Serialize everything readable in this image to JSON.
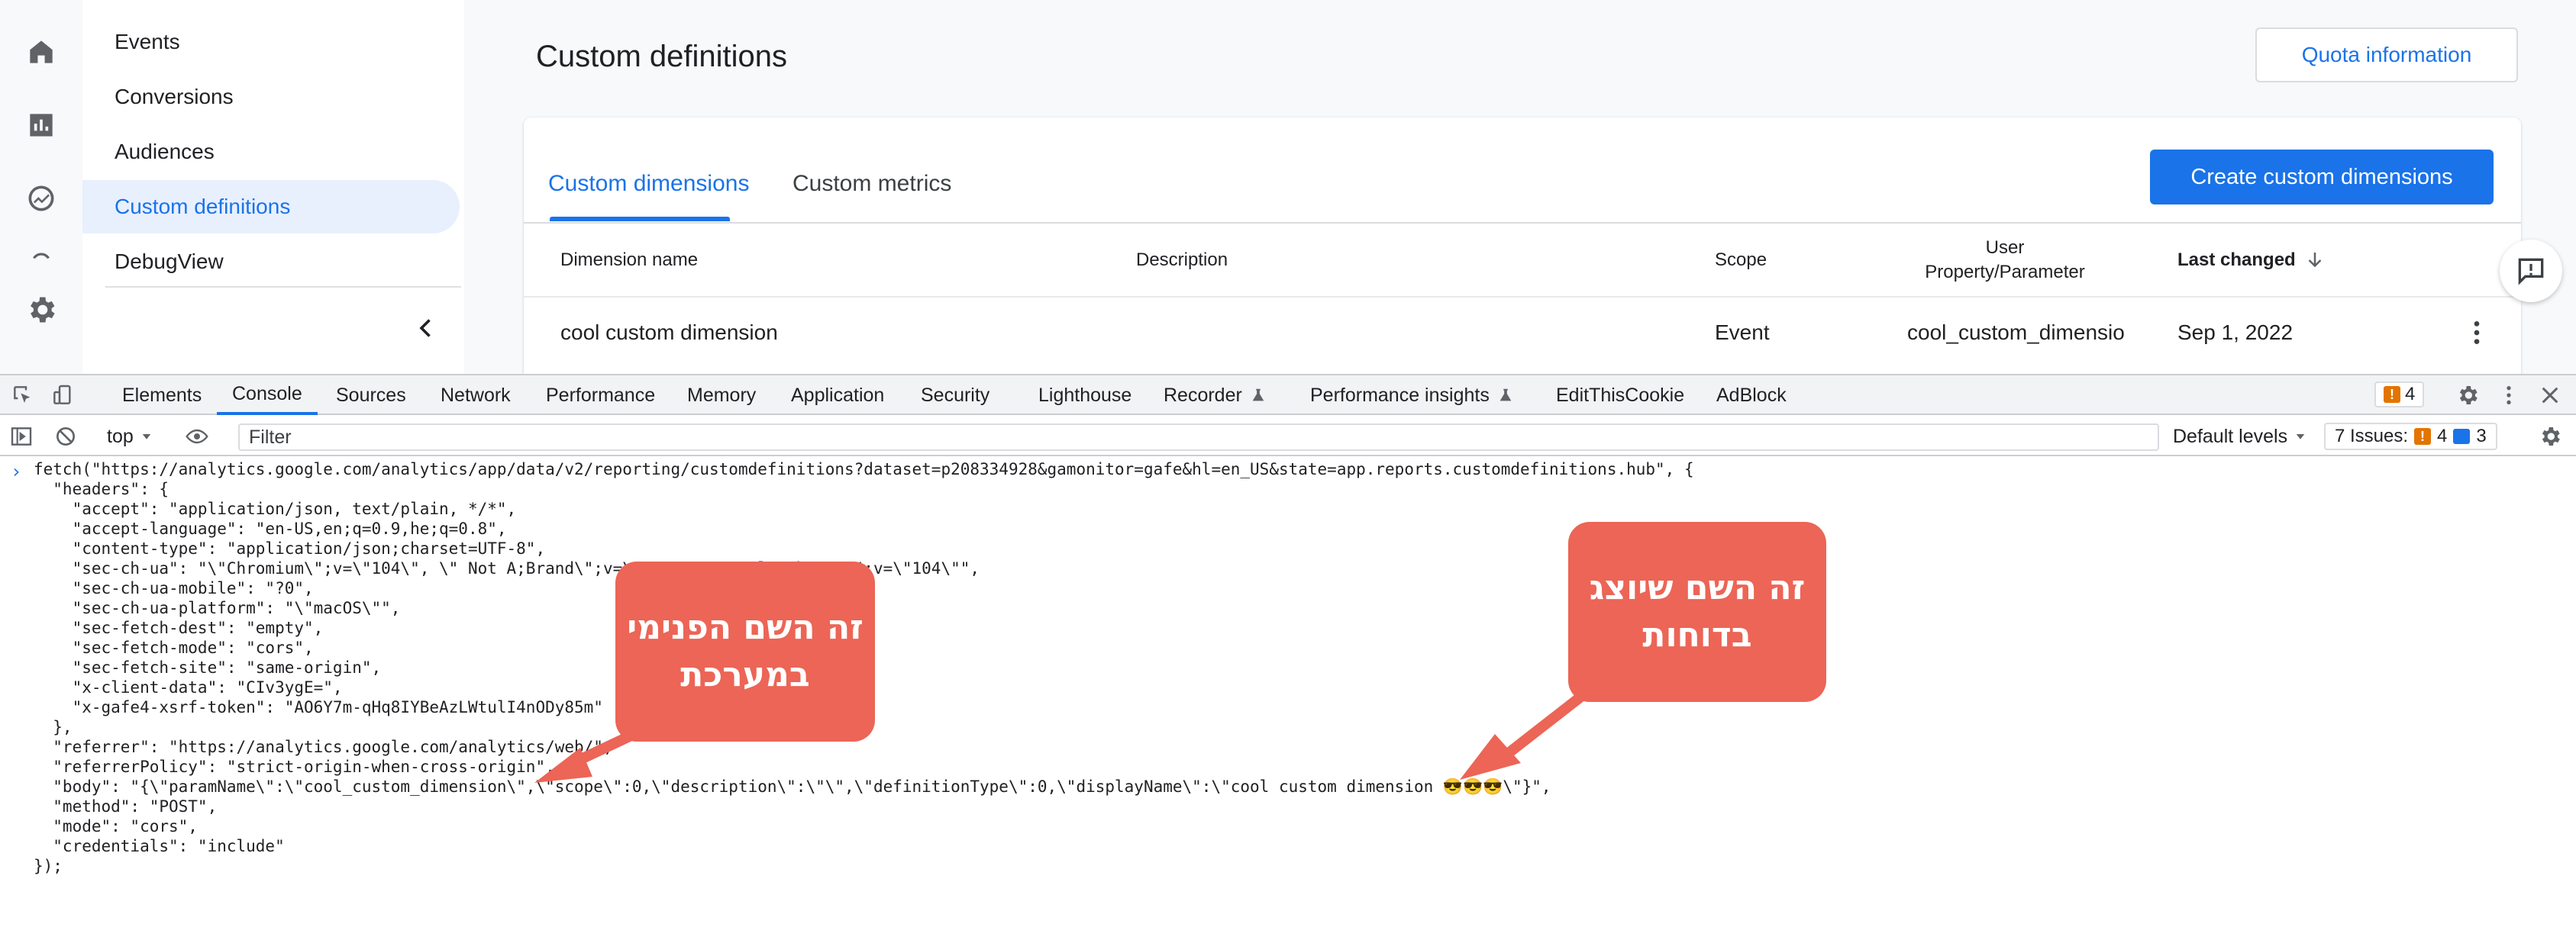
{
  "sidenav": {
    "items": [
      {
        "label": "Events"
      },
      {
        "label": "Conversions"
      },
      {
        "label": "Audiences"
      },
      {
        "label": "Custom definitions",
        "active": true
      },
      {
        "label": "DebugView"
      }
    ]
  },
  "page": {
    "title": "Custom definitions",
    "quota_button": "Quota information"
  },
  "tabs": [
    {
      "label": "Custom dimensions",
      "active": true
    },
    {
      "label": "Custom metrics"
    }
  ],
  "create_button": "Create custom dimensions",
  "table": {
    "headers": {
      "name": "Dimension name",
      "description": "Description",
      "scope": "Scope",
      "user_line1": "User",
      "user_line2": "Property/Parameter",
      "last_changed": "Last changed"
    },
    "rows": [
      {
        "name": "cool custom dimension",
        "description": "",
        "scope": "Event",
        "param": "cool_custom_dimensio",
        "date": "Sep 1, 2022"
      }
    ]
  },
  "devtools": {
    "tabs": [
      "Elements",
      "Console",
      "Sources",
      "Network",
      "Performance",
      "Memory",
      "Application",
      "Security",
      "Lighthouse",
      "Recorder",
      "Performance insights",
      "EditThisCookie",
      "AdBlock"
    ],
    "warning_count": "4",
    "context": "top",
    "filter_placeholder": "Filter",
    "levels": "Default levels",
    "issues_label": "7 Issues:",
    "issues_warn": "4",
    "issues_info": "3"
  },
  "console": {
    "lines": [
      "fetch(\"https://analytics.google.com/analytics/app/data/v2/reporting/customdefinitions?dataset=p208334928&gamonitor=gafe&hl=en_US&state=app.reports.customdefinitions.hub\", {",
      "  \"headers\": {",
      "    \"accept\": \"application/json, text/plain, */*\",",
      "    \"accept-language\": \"en-US,en;q=0.9,he;q=0.8\",",
      "    \"content-type\": \"application/json;charset=UTF-8\",",
      "    \"sec-ch-ua\": \"\\\"Chromium\\\";v=\\\"104\\\", \\\" Not A;Brand\\\";v=\\\"99\\\", \\\"Google Chrome\\\";v=\\\"104\\\"\",",
      "    \"sec-ch-ua-mobile\": \"?0\",",
      "    \"sec-ch-ua-platform\": \"\\\"macOS\\\"\",",
      "    \"sec-fetch-dest\": \"empty\",",
      "    \"sec-fetch-mode\": \"cors\",",
      "    \"sec-fetch-site\": \"same-origin\",",
      "    \"x-client-data\": \"CIv3ygE=\",",
      "    \"x-gafe4-xsrf-token\": \"AO6Y7m-qHq8IYBeAzLWtulI4nODy85m\"",
      "  },",
      "  \"referrer\": \"https://analytics.google.com/analytics/web/\",",
      "  \"referrerPolicy\": \"strict-origin-when-cross-origin\",",
      "  \"body\": \"{\\\"paramName\\\":\\\"cool_custom_dimension\\\",\\\"scope\\\":0,\\\"description\\\":\\\"\\\",\\\"definitionType\\\":0,\\\"displayName\\\":\\\"cool custom dimension 😎😎😎\\\"}\",",
      "  \"method\": \"POST\",",
      "  \"mode\": \"cors\",",
      "  \"credentials\": \"include\"",
      "});"
    ]
  },
  "annotations": {
    "internal_line1": "זה השם הפנימי",
    "internal_line2": "במערכת",
    "display_line1": "זה השם שיוצג",
    "display_line2": "בדוחות",
    "color": "#ec6556"
  }
}
